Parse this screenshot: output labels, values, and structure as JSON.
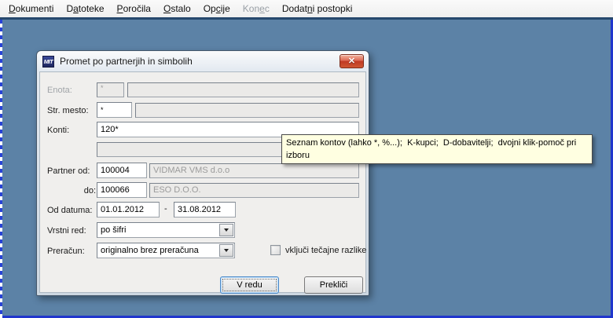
{
  "menu": {
    "items": [
      {
        "label": "Dokumenti",
        "underline_index": 0,
        "disabled": false
      },
      {
        "label": "Datoteke",
        "underline_index": 1,
        "disabled": false
      },
      {
        "label": "Poročila",
        "underline_index": 0,
        "disabled": false
      },
      {
        "label": "Ostalo",
        "underline_index": 0,
        "disabled": false
      },
      {
        "label": "Opcije",
        "underline_index": 2,
        "disabled": false
      },
      {
        "label": "Konec",
        "underline_index": 3,
        "disabled": true
      },
      {
        "label": "Dodatni postopki",
        "underline_index": 5,
        "disabled": false
      }
    ]
  },
  "dialog": {
    "title": "Promet po partnerjih in simbolih",
    "icon_text": "MIT",
    "close_icon": "✕",
    "fields": {
      "enota": {
        "label": "Enota:",
        "star": "*",
        "value": ""
      },
      "str_mesto": {
        "label": "Str. mesto:",
        "star": "*",
        "value": ""
      },
      "konti": {
        "label": "Konti:",
        "value": "120*"
      },
      "konti_extra": {
        "value": ""
      },
      "partner_od": {
        "label": "Partner od:",
        "code": "100004",
        "name": "VIDMAR VMS d.o.o"
      },
      "partner_do": {
        "label": "do:",
        "code": "100066",
        "name": "ESO D.O.O."
      },
      "od_datuma": {
        "label": "Od datuma:",
        "from": "01.01.2012",
        "separator": "-",
        "to": "31.08.2012"
      },
      "vrstni_red": {
        "label": "Vrstni red:",
        "value": "po šifri"
      },
      "preracun": {
        "label": "Preračun:",
        "value": "originalno brez preračuna"
      },
      "tecajne": {
        "label": "vključi tečajne razlike",
        "checked": false
      }
    },
    "buttons": {
      "ok": "V redu",
      "cancel": "Prekliči"
    }
  },
  "tooltip": {
    "text": "Seznam kontov (lahko *, %...);  K-kupci;  D-dobavitelji;  dvojni klik-pomoč pri izboru"
  },
  "colors": {
    "desktop_bg": "#5c82a6",
    "app_border_blue": "#2036cd",
    "tooltip_bg": "#ffffe1",
    "close_button_red": "#c03a24",
    "dialog_client_bg": "#f0efed"
  }
}
